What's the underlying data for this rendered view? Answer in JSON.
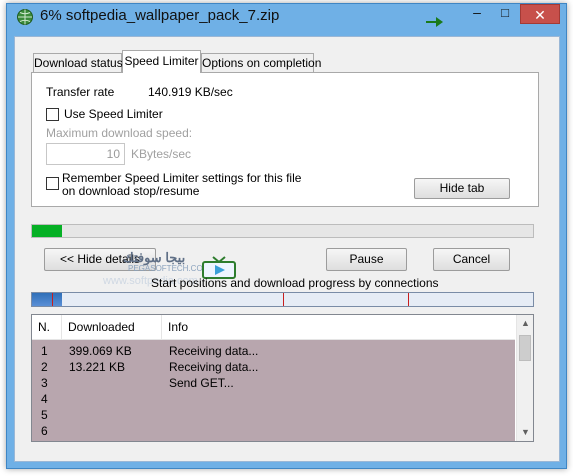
{
  "window": {
    "title": "6% softpedia_wallpaper_pack_7.zip",
    "controls": {
      "minimize": "–",
      "maximize": "□",
      "close": "✕"
    }
  },
  "tabs": [
    {
      "label": "Download status",
      "active": false
    },
    {
      "label": "Speed Limiter",
      "active": true
    },
    {
      "label": "Options on completion",
      "active": false
    }
  ],
  "speed_limiter": {
    "transfer_rate_label": "Transfer rate",
    "transfer_rate_value": "140.919  KB/sec",
    "use_limiter_label": "Use Speed Limiter",
    "use_limiter_checked": false,
    "max_speed_label": "Maximum download speed:",
    "max_speed_value": "10",
    "max_speed_unit": "KBytes/sec",
    "remember_label_line1": "Remember Speed Limiter settings for this file",
    "remember_label_line2": "on download stop/resume",
    "remember_checked": false,
    "hide_tab_button": "Hide tab"
  },
  "progress": {
    "percent": 6,
    "fill_color": "#06b025"
  },
  "buttons": {
    "hide_details": "<< Hide details",
    "pause": "Pause",
    "cancel": "Cancel"
  },
  "watermark": {
    "arabic": "بيجا سوفتك",
    "latin": "PEGASOFTECH.COM",
    "ghost": "www.softpedia.com"
  },
  "connections": {
    "label": "Start positions and download progress by connections",
    "markers_fraction": [
      0.0,
      0.5,
      0.75
    ],
    "first_segment_fraction": 0.06
  },
  "table": {
    "columns": [
      "N.",
      "Downloaded",
      "Info"
    ],
    "rows": [
      {
        "n": "1",
        "downloaded": "399.069  KB",
        "info": "Receiving data..."
      },
      {
        "n": "2",
        "downloaded": "13.221  KB",
        "info": "Receiving data..."
      },
      {
        "n": "3",
        "downloaded": "",
        "info": "Send GET..."
      },
      {
        "n": "4",
        "downloaded": "",
        "info": ""
      },
      {
        "n": "5",
        "downloaded": "",
        "info": ""
      },
      {
        "n": "6",
        "downloaded": "",
        "info": ""
      }
    ]
  }
}
